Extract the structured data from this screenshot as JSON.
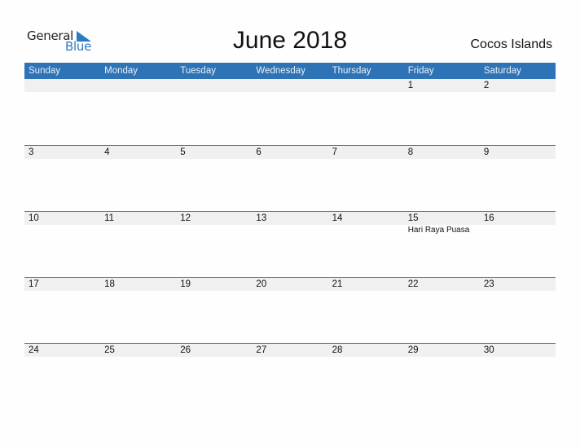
{
  "logo": {
    "line1": "General",
    "line2": "Blue",
    "icon": "triangle-flag-icon",
    "accent_color": "#2a7bc4"
  },
  "header": {
    "title": "June 2018",
    "country": "Cocos Islands"
  },
  "colors": {
    "header_bg": "#2e73b5",
    "day_band_bg": "#f0f0f0"
  },
  "weekdays": [
    "Sunday",
    "Monday",
    "Tuesday",
    "Wednesday",
    "Thursday",
    "Friday",
    "Saturday"
  ],
  "weeks": [
    {
      "days": [
        "",
        "",
        "",
        "",
        "",
        "1",
        "2"
      ],
      "events": [
        "",
        "",
        "",
        "",
        "",
        "",
        ""
      ]
    },
    {
      "days": [
        "3",
        "4",
        "5",
        "6",
        "7",
        "8",
        "9"
      ],
      "events": [
        "",
        "",
        "",
        "",
        "",
        "",
        ""
      ]
    },
    {
      "days": [
        "10",
        "11",
        "12",
        "13",
        "14",
        "15",
        "16"
      ],
      "events": [
        "",
        "",
        "",
        "",
        "",
        "Hari Raya Puasa",
        ""
      ]
    },
    {
      "days": [
        "17",
        "18",
        "19",
        "20",
        "21",
        "22",
        "23"
      ],
      "events": [
        "",
        "",
        "",
        "",
        "",
        "",
        ""
      ]
    },
    {
      "days": [
        "24",
        "25",
        "26",
        "27",
        "28",
        "29",
        "30"
      ],
      "events": [
        "",
        "",
        "",
        "",
        "",
        "",
        ""
      ]
    }
  ]
}
